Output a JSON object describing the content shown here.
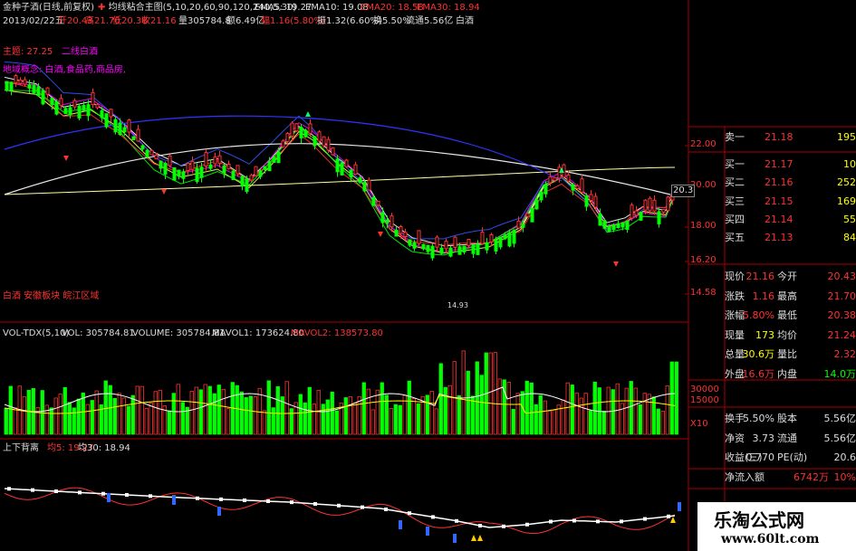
{
  "header": {
    "title": "金种子酒(日线,前复权)",
    "indicator_name": "均线粘合主图",
    "indicator_params": "(5,10,20,60,90,120,240,5,30)",
    "ema5": "EMA5: 19.27",
    "ema10": "EMA10: 19.08",
    "ema20": "EMA20: 18.58",
    "ema30": "EMA30: 18.94"
  },
  "bar_info": {
    "date": "2013/02/22五",
    "open": "开20.43",
    "high": "高21.70",
    "low": "低20.38",
    "close": "收21.16",
    "volume": "量305784.8",
    "amount": "额6.49亿",
    "change_pct": "幅1.16(5.80%)",
    "amplitude": "振1.32(6.60%)",
    "turnover": "换5.50%",
    "float": "流通5.56亿",
    "sector": "白酒"
  },
  "main_labels": {
    "label1": "主题: 27.25",
    "label2": "二线白酒",
    "label3": "地域概念: 白酒,食品药,商品房,",
    "bottom_label": "白酒 安徽板块 皖江区域",
    "low_marker": "14.93"
  },
  "price_axis": [
    "22.00",
    "20.00",
    "18.00",
    "16.20",
    "14.58"
  ],
  "price_marker": "20.3",
  "volume_header": {
    "name": "VOL-TDX(5,10)",
    "vol": "VOL: 305784.81",
    "volume": "VOLUME: 305784.81",
    "mavol1": "MAVOL1: 173624.80",
    "mavol2": "MAVOL2: 138573.80"
  },
  "volume_axis": [
    "30000",
    "15000",
    "X10"
  ],
  "lower_header": {
    "name": "上下背离",
    "ma5": "均5: 19.27",
    "ma30": "均30: 18.94"
  },
  "quote": {
    "asks": [
      {
        "label": "卖一",
        "price": "21.18",
        "vol": "195"
      }
    ],
    "bids": [
      {
        "label": "买一",
        "price": "21.17",
        "vol": "10"
      },
      {
        "label": "买二",
        "price": "21.16",
        "vol": "252"
      },
      {
        "label": "买三",
        "price": "21.15",
        "vol": "169"
      },
      {
        "label": "买四",
        "price": "21.14",
        "vol": "55"
      },
      {
        "label": "买五",
        "price": "21.13",
        "vol": "84"
      }
    ],
    "stats": [
      {
        "l1": "现价",
        "v1": "21.16",
        "l2": "今开",
        "v2": "20.43"
      },
      {
        "l1": "涨跌",
        "v1": "1.16",
        "l2": "最高",
        "v2": "21.70"
      },
      {
        "l1": "涨幅",
        "v1": "5.80%",
        "l2": "最低",
        "v2": "20.38"
      },
      {
        "l1": "现量",
        "v1": "173",
        "l2": "均价",
        "v2": "21.24"
      },
      {
        "l1": "总量",
        "v1": "30.6万",
        "l2": "量比",
        "v2": "2.32"
      },
      {
        "l1": "外盘",
        "v1": "16.6万",
        "l2": "内盘",
        "v2": "14.0万"
      },
      {
        "l1": "换手",
        "v1": "5.50%",
        "l2": "股本",
        "v2": "5.56亿"
      },
      {
        "l1": "净资",
        "v1": "3.73",
        "l2": "流通",
        "v2": "5.56亿"
      },
      {
        "l1": "收益(三)",
        "v1": "0.770",
        "l2": "PE(动)",
        "v2": "20.6"
      },
      {
        "l1": "净流入额",
        "v1": "6742万",
        "l2": "",
        "v2": "10%"
      }
    ]
  },
  "watermark": {
    "title": "乐淘公式网",
    "url": "www.60lt.com"
  },
  "colors": {
    "up": "#ff3232",
    "down": "#00ff00",
    "axis": "#aa0000",
    "yellow": "#ffff00",
    "magenta": "#ff00ff"
  }
}
